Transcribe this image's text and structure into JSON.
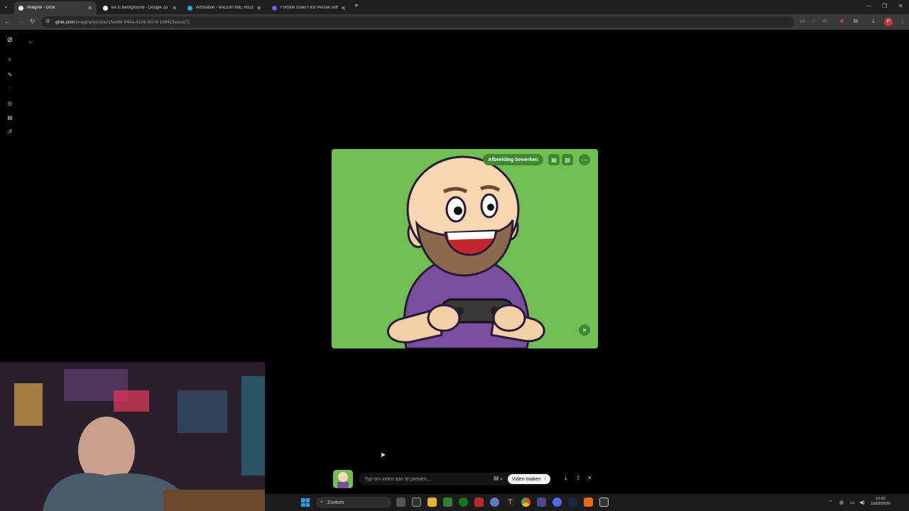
{
  "browser": {
    "tabs": [
      {
        "title": "Imagine - Grok",
        "active": true
      },
      {
        "title": "ea fc background - Google Zo",
        "active": false
      },
      {
        "title": "ArtStation - VALENTINE, RED D",
        "active": false
      },
      {
        "title": "Fortnite Goes First Person with",
        "active": false
      }
    ],
    "new_tab": "+",
    "url_domain": "grok.com",
    "url_path": "/imagine/post/a21fae68-940a-4126-807d-1d8415eeca72",
    "profile_initial": "P"
  },
  "card": {
    "edit_label": "Afbeelding bewerken"
  },
  "prompt": {
    "placeholder": "Typ om video aan te passen...",
    "video_button": "Video maken"
  },
  "taskbar": {
    "search_label": "Zoeken",
    "time": "10:22",
    "date": "10/02/2026"
  },
  "colors": {
    "card_green": "#6fbf52",
    "button_green": "#3f8a2f",
    "shirt_purple": "#7a4fa0"
  }
}
